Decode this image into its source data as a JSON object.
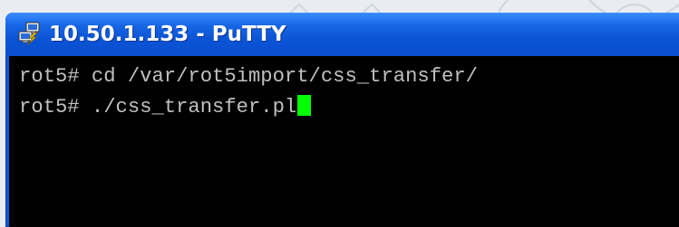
{
  "window": {
    "title": "10.50.1.133 - PuTTY",
    "icon": "putty-app-icon"
  },
  "terminal": {
    "lines": [
      "rot5# cd /var/rot5import/css_transfer/",
      "rot5# ./css_transfer.pl"
    ],
    "cursor_color": "#00ff00",
    "text_color": "#c0c0c0",
    "background_color": "#000000"
  },
  "colors": {
    "titlebar": "#0a57d6",
    "title_text": "#ffffff"
  }
}
